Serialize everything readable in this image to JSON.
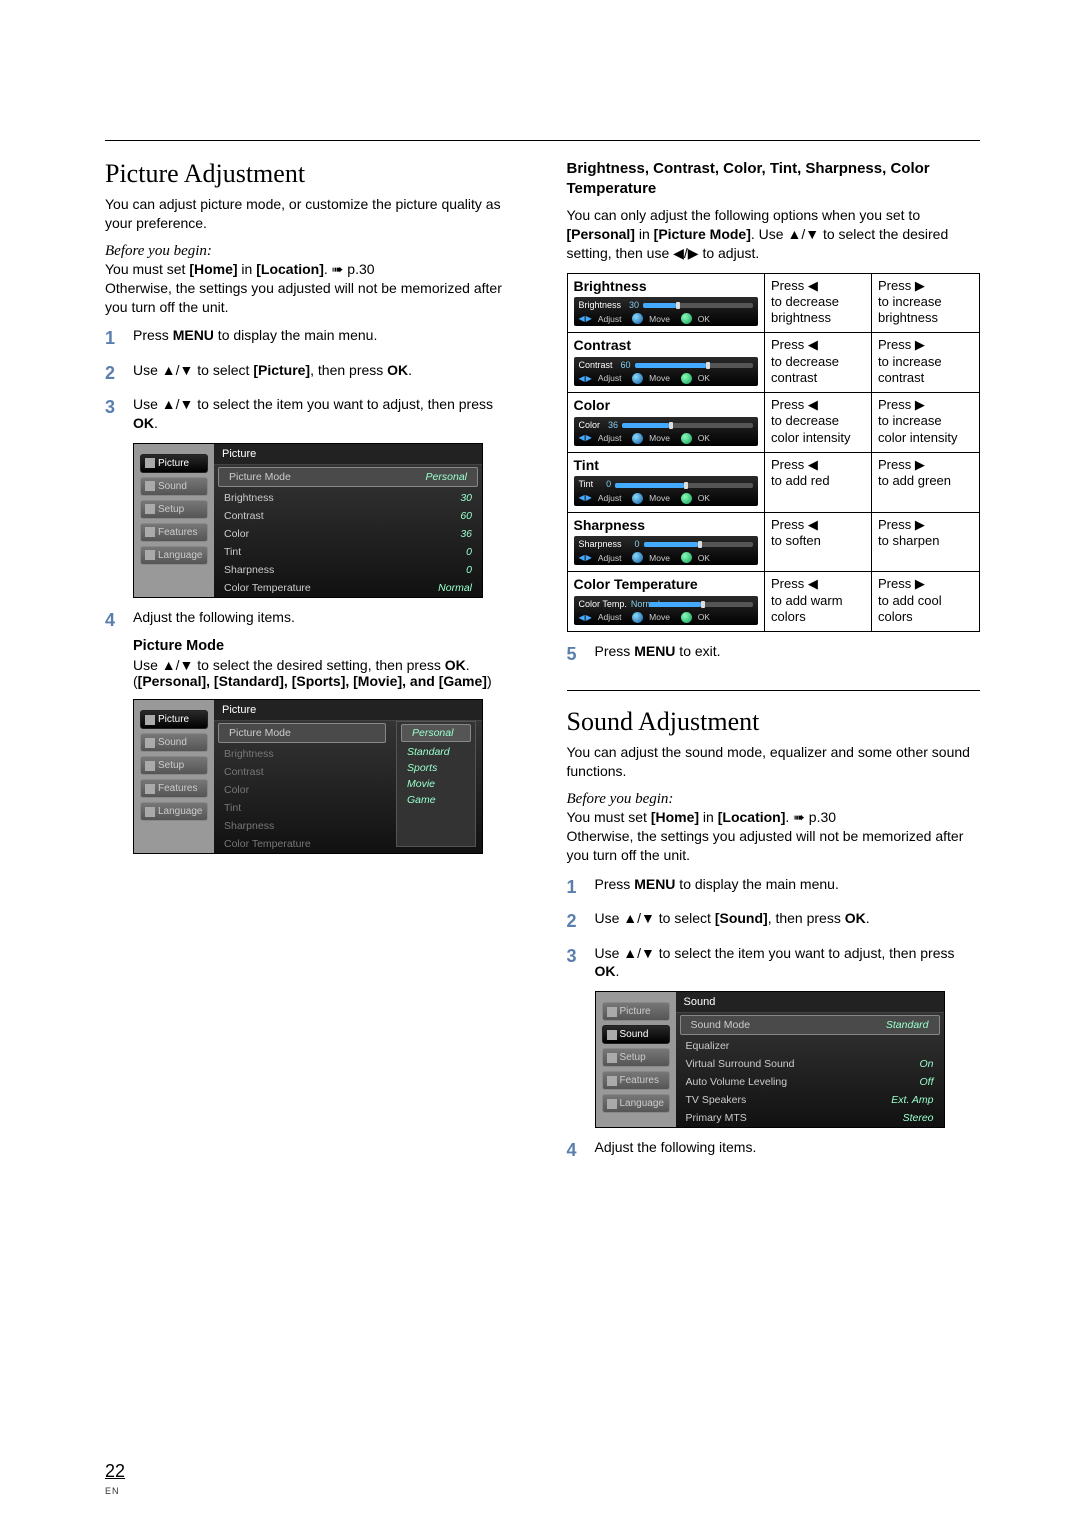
{
  "page": {
    "number": "22",
    "lang_code": "EN"
  },
  "left": {
    "title": "Picture Adjustment",
    "intro": "You can adjust picture mode, or customize the picture quality as your preference.",
    "before_begin_label": "Before you begin:",
    "begin_line1_a": "You must set ",
    "begin_line1_b": "[Home]",
    "begin_line1_c": " in ",
    "begin_line1_d": "[Location]",
    "begin_line1_e": ". ➠ p.30",
    "begin_line2": "Otherwise, the settings you adjusted will not be memorized after you turn off the unit.",
    "step1_a": "Press ",
    "step1_b": "MENU",
    "step1_c": " to display the main menu.",
    "step2_a": "Use ▲/▼ to select ",
    "step2_b": "[Picture]",
    "step2_c": ", then press ",
    "step2_d": "OK",
    "step2_e": ".",
    "step3_a": "Use ▲/▼ to select the item you want to adjust, then press ",
    "step3_b": "OK",
    "step3_c": ".",
    "step4": "Adjust the following items.",
    "pm_heading": "Picture Mode",
    "pm_text_a": "Use ▲/▼ to select the desired setting, then press ",
    "pm_text_b": "OK",
    "pm_text_c": ".\n(",
    "pm_text_list": "[Personal], [Standard], [Sports], [Movie], and [Game]",
    "pm_text_d": ")"
  },
  "osd": {
    "tabs": [
      "Picture",
      "Sound",
      "Setup",
      "Features",
      "Language"
    ],
    "title": "Picture",
    "rows": [
      {
        "label": "Picture Mode",
        "val": "Personal",
        "sel": true
      },
      {
        "label": "Brightness",
        "val": "30"
      },
      {
        "label": "Contrast",
        "val": "60"
      },
      {
        "label": "Color",
        "val": "36"
      },
      {
        "label": "Tint",
        "val": "0"
      },
      {
        "label": "Sharpness",
        "val": "0"
      },
      {
        "label": "Color Temperature",
        "val": "Normal"
      }
    ]
  },
  "osd2": {
    "tabs": [
      "Picture",
      "Sound",
      "Setup",
      "Features",
      "Language"
    ],
    "title": "Picture",
    "top_row": {
      "label": "Picture Mode"
    },
    "options": [
      "Personal",
      "Standard",
      "Sports",
      "Movie",
      "Game"
    ],
    "greyed": [
      "Brightness",
      "Contrast",
      "Color",
      "Tint",
      "Sharpness",
      "Color Temperature"
    ]
  },
  "right": {
    "heading": "Brightness, Contrast, Color, Tint, Sharpness, Color Temperature",
    "intro_a": "You can only adjust the following options when you set to ",
    "intro_b": "[Personal]",
    "intro_c": " in ",
    "intro_d": "[Picture Mode]",
    "intro_e": ". Use ▲/▼ to select the desired setting, then use ◀/▶ to adjust.",
    "table": [
      {
        "name": "Brightness",
        "osd_label": "Brightness",
        "osd_val": "30",
        "fill": 30,
        "left": "Press ◀\nto decrease\nbrightness",
        "right": "Press ▶\nto increase\nbrightness"
      },
      {
        "name": "Contrast",
        "osd_label": "Contrast",
        "osd_val": "60",
        "fill": 60,
        "left": "Press ◀\nto decrease\ncontrast",
        "right": "Press ▶\nto increase\ncontrast"
      },
      {
        "name": "Color",
        "osd_label": "Color",
        "osd_val": "36",
        "fill": 36,
        "left": "Press ◀\nto decrease\ncolor intensity",
        "right": "Press ▶\nto increase\ncolor intensity"
      },
      {
        "name": "Tint",
        "osd_label": "Tint",
        "osd_val": "0",
        "fill": 50,
        "left": "Press ◀\nto add red",
        "right": "Press ▶\nto add green"
      },
      {
        "name": "Sharpness",
        "osd_label": "Sharpness",
        "osd_val": "0",
        "fill": 50,
        "left": "Press ◀\nto soften",
        "right": "Press ▶\nto sharpen"
      },
      {
        "name": "Color Temperature",
        "osd_label": "Color Temp.",
        "osd_val": "Normal",
        "fill": 50,
        "left": "Press ◀\nto add warm\ncolors",
        "right": "Press ▶\nto add cool\ncolors"
      }
    ],
    "step5_a": "Press ",
    "step5_b": "MENU",
    "step5_c": " to exit."
  },
  "sound": {
    "title": "Sound Adjustment",
    "intro": "You can adjust the sound mode, equalizer and some other sound functions.",
    "before_begin_label": "Before you begin:",
    "begin_line1_a": "You must set ",
    "begin_line1_b": "[Home]",
    "begin_line1_c": " in ",
    "begin_line1_d": "[Location]",
    "begin_line1_e": ". ➠ p.30",
    "begin_line2": "Otherwise, the settings you adjusted will not be memorized after you turn off the unit.",
    "step1_a": "Press ",
    "step1_b": "MENU",
    "step1_c": " to display the main menu.",
    "step2_a": "Use ▲/▼ to select ",
    "step2_b": "[Sound]",
    "step2_c": ", then press ",
    "step2_d": "OK",
    "step2_e": ".",
    "step3_a": "Use ▲/▼ to select the item you want to adjust, then press ",
    "step3_b": "OK",
    "step3_c": ".",
    "step4": "Adjust the following items."
  },
  "osd3": {
    "tabs": [
      "Picture",
      "Sound",
      "Setup",
      "Features",
      "Language"
    ],
    "title": "Sound",
    "rows": [
      {
        "label": "Sound Mode",
        "val": "Standard",
        "sel": true
      },
      {
        "label": "Equalizer",
        "val": ""
      },
      {
        "label": "Virtual Surround Sound",
        "val": "On"
      },
      {
        "label": "Auto Volume Leveling",
        "val": "Off"
      },
      {
        "label": "TV Speakers",
        "val": "Ext. Amp"
      },
      {
        "label": "Primary MTS",
        "val": "Stereo"
      }
    ]
  },
  "mini_ctrl": {
    "adjust": "Adjust",
    "move": "Move",
    "ok": "OK"
  }
}
